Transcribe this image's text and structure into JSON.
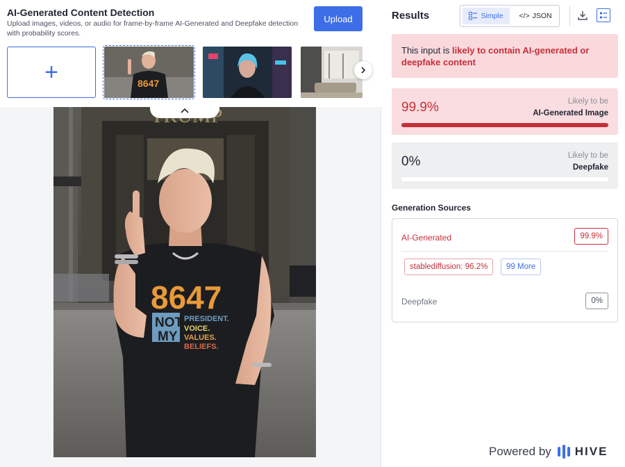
{
  "header": {
    "title": "AI-Generated Content Detection",
    "description": "Upload images, videos, or audio for frame-by-frame AI-Generated and Deepfake detection with probability scores.",
    "upload_label": "Upload"
  },
  "thumbnails": [
    {
      "name": "thumb-woman-tshirt",
      "selected": true,
      "shirt_text": "8647"
    },
    {
      "name": "thumb-neon-woman",
      "selected": false
    },
    {
      "name": "thumb-interior",
      "selected": false
    }
  ],
  "preview": {
    "shirt_number": "8647",
    "shirt_line1": "NOT",
    "shirt_line2": "MY",
    "shirt_words": [
      "PRESIDENT.",
      "VOICE.",
      "VALUES.",
      "BELIEFS."
    ]
  },
  "results": {
    "title": "Results",
    "view_simple": "Simple",
    "view_json": "JSON",
    "verdict_prefix": "This input is ",
    "verdict_highlight": "likely to contain AI-generated or deepfake content"
  },
  "scores": {
    "ai_generated": {
      "value": "99.9%",
      "fraction": 0.999,
      "label_top": "Likely to be",
      "label_bottom": "AI-Generated Image"
    },
    "deepfake": {
      "value": "0%",
      "fraction": 0.0,
      "label_top": "Likely to be",
      "label_bottom": "Deepfake"
    }
  },
  "generation_sources": {
    "title": "Generation Sources",
    "ai_label": "AI-Generated",
    "ai_value": "99.9%",
    "top_source": "stablediffusion: 96.2%",
    "more_label": "99 More",
    "deepfake_label": "Deepfake",
    "deepfake_value": "0%"
  },
  "footer": {
    "powered_by": "Powered by",
    "brand": "HIVE"
  },
  "colors": {
    "accent_blue": "#3d6ee8",
    "alert_red": "#c62f3a",
    "alert_bg": "#f9d9dc"
  }
}
